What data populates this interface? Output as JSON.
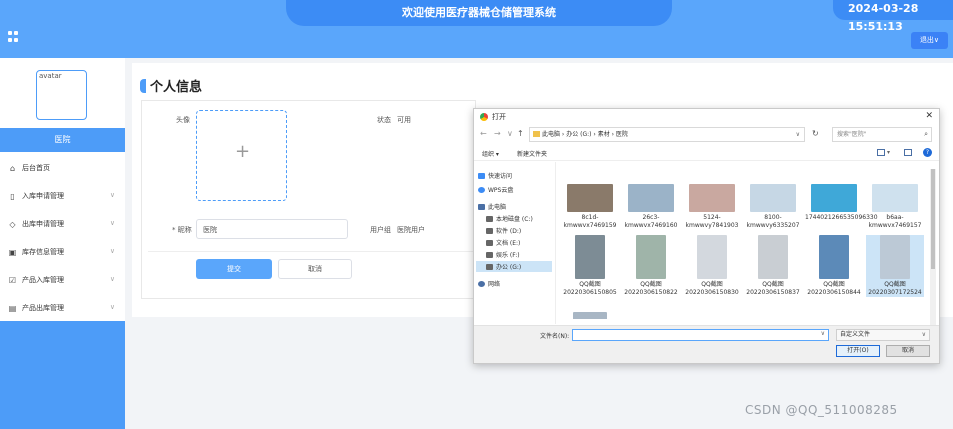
{
  "header": {
    "title": "欢迎使用医疗器械仓储管理系统",
    "datetime": "2024-03-28 15:51:13",
    "exit_label": "退出∨"
  },
  "sidebar": {
    "avatar_alt": "avatar",
    "role": "医院",
    "items": [
      {
        "label": "后台首页",
        "icon": "home-icon"
      },
      {
        "label": "入库申请管理",
        "icon": "bookmark-icon"
      },
      {
        "label": "出库申请管理",
        "icon": "tag-icon"
      },
      {
        "label": "库存信息管理",
        "icon": "inbox-icon"
      },
      {
        "label": "产品入库管理",
        "icon": "clipboard-icon"
      },
      {
        "label": "产品出库管理",
        "icon": "message-icon"
      }
    ]
  },
  "main": {
    "title": "个人信息",
    "avatar_label": "头像",
    "status_label": "状态",
    "status_value": "可用",
    "name_label": "* 昵称",
    "name_value": "医院",
    "role_label": "用户组",
    "role_value": "医院用户",
    "submit_label": "提交",
    "cancel_label": "取消"
  },
  "dialog": {
    "title": "打开",
    "path": "此电脑 › 办公 (G:) › 素材 › 医院",
    "search_placeholder": "搜索\"医院\"",
    "organize": "组织 ▾",
    "new_folder": "新建文件夹",
    "nav": [
      {
        "label": "快速访问",
        "color": "#3c8cf5"
      },
      {
        "label": "WPS云盘",
        "color": "#3c8cf5"
      },
      {
        "label": "此电脑",
        "color": "#4a6fa5"
      },
      {
        "label": "本地磁盘 (C:)",
        "color": "#666666"
      },
      {
        "label": "软件 (D:)",
        "color": "#666666"
      },
      {
        "label": "文档 (E:)",
        "color": "#666666"
      },
      {
        "label": "娱乐 (F:)",
        "color": "#666666"
      },
      {
        "label": "办公 (G:)",
        "color": "#666666"
      },
      {
        "label": "网络",
        "color": "#4a6fa5"
      }
    ],
    "files_row1": [
      {
        "name": "8c1d-kmwwvx7469159",
        "color": "#8a7a6a"
      },
      {
        "name": "26c3-kmwwvx7469160",
        "color": "#9bb3c8"
      },
      {
        "name": "5124-kmwwvy7841903",
        "color": "#c9a8a0"
      },
      {
        "name": "8100-kmwwvy6335207",
        "color": "#c6d7e5"
      },
      {
        "name": "1744021266535096330",
        "color": "#3fa8d8"
      },
      {
        "name": "b6aa-kmwwvx7469157",
        "color": "#cfe1ee"
      }
    ],
    "files_row2": [
      {
        "name": "QQ截图20220306150805",
        "color": "#7d8c95"
      },
      {
        "name": "QQ截图20220306150822",
        "color": "#9fb4a9"
      },
      {
        "name": "QQ截图20220306150830",
        "color": "#d3d8de"
      },
      {
        "name": "QQ截图20220306150837",
        "color": "#c9ced3"
      },
      {
        "name": "QQ截图20220306150844",
        "color": "#5c8ab8"
      },
      {
        "name": "QQ截图20220307172524",
        "color": "#bcc9d6"
      }
    ],
    "filename_label": "文件名(N):",
    "filetype": "自定义文件",
    "open_label": "打开(O)",
    "cancel_label": "取消"
  },
  "watermark": "CSDN @QQ_511008285"
}
